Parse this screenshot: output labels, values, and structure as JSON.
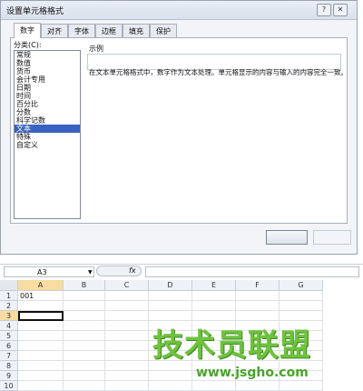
{
  "dialog": {
    "title": "设置单元格格式",
    "help_glyph": "?",
    "close_glyph": "✕",
    "tabs": [
      "数字",
      "对齐",
      "字体",
      "边框",
      "填充",
      "保护"
    ],
    "active_tab": "数字",
    "category_label": "分类(C):",
    "categories": [
      "常规",
      "数值",
      "货币",
      "会计专用",
      "日期",
      "时间",
      "百分比",
      "分数",
      "科学记数",
      "文本",
      "特殊",
      "自定义"
    ],
    "selected_category": "文本",
    "sample_label": "示例",
    "description": "在文本单元格格式中，数字作为文本处理。单元格显示的内容与输入的内容完全一致。"
  },
  "sheet": {
    "namebox": "A3",
    "namebox_arrow": "▼",
    "fx_glyph": "fx",
    "columns": [
      "A",
      "B",
      "C",
      "D",
      "E",
      "F",
      "G"
    ],
    "rows": [
      "1",
      "2",
      "3",
      "4",
      "5",
      "6",
      "7",
      "8",
      "9",
      "10"
    ],
    "active_column": "A",
    "active_row": "3",
    "cells": {
      "A1": "001"
    }
  },
  "watermark": {
    "title": "技术员联盟",
    "url": "www.jsgho.com"
  }
}
